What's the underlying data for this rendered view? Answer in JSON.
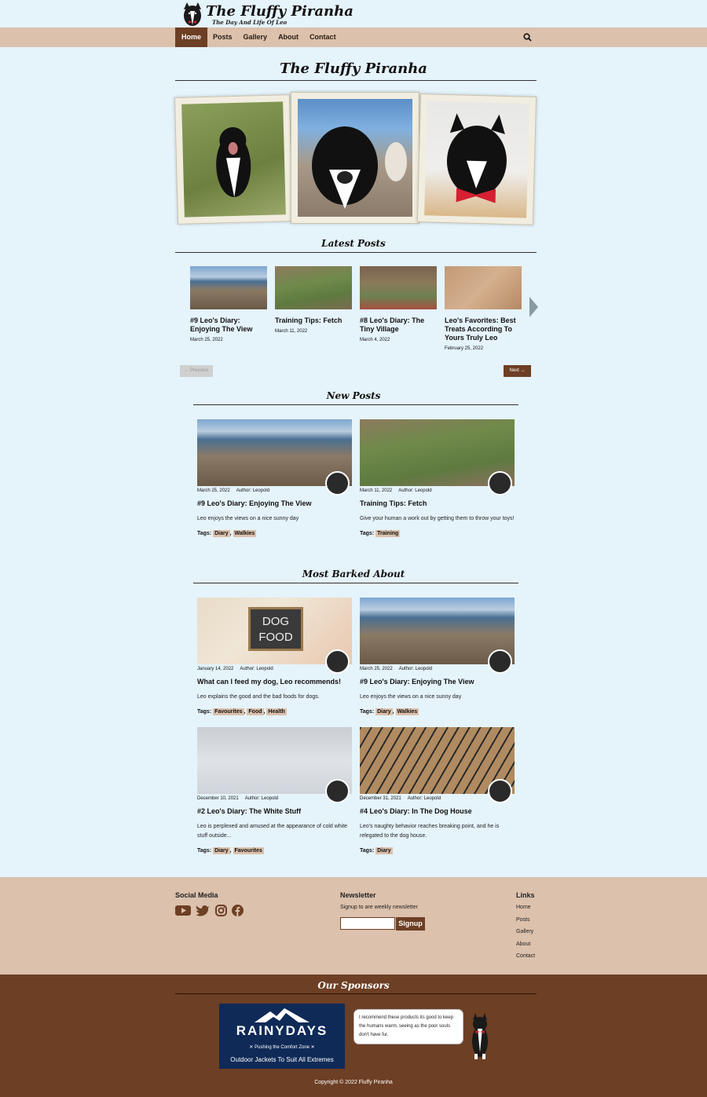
{
  "site": {
    "title": "The Fluffy Piranha",
    "tagline": "The Day And Life Of Leo"
  },
  "nav": {
    "items": [
      "Home",
      "Posts",
      "Gallery",
      "About",
      "Contact"
    ],
    "active": "Home"
  },
  "hero": {
    "title": "The Fluffy Piranha"
  },
  "latest": {
    "title": "Latest Posts",
    "posts": [
      {
        "title": "#9 Leo's Diary: Enjoying The View",
        "date": "March 25, 2022"
      },
      {
        "title": "Training Tips: Fetch",
        "date": "March 11, 2022"
      },
      {
        "title": "#8 Leo's Diary: The Tiny Village",
        "date": "March 4, 2022"
      },
      {
        "title": "Leo's Favorites: Best Treats According To Yours Truly Leo",
        "date": "February 25, 2022"
      }
    ],
    "prev": "← Previous",
    "next": "Next →"
  },
  "new_posts": {
    "title": "New Posts",
    "posts": [
      {
        "date": "March 25, 2022",
        "author": "Author: Leopold",
        "title": "#9 Leo's Diary: Enjoying The View",
        "excerpt": "Leo enjoys the views on a nice sunny day",
        "tags_label": "Tags:",
        "tags": [
          "Diary",
          "Walkies"
        ]
      },
      {
        "date": "March 11, 2022",
        "author": "Author: Leopold",
        "title": "Training Tips: Fetch",
        "excerpt": "Give your human a work out by getting them to throw your toys!",
        "tags_label": "Tags:",
        "tags": [
          "Training"
        ]
      }
    ]
  },
  "barked": {
    "title": "Most Barked About",
    "posts": [
      {
        "date": "January 14, 2022",
        "author": "Author: Leopold",
        "title": "What can I feed my dog, Leo recommends!",
        "excerpt": "Leo explains the good and the bad foods for dogs.",
        "tags_label": "Tags:",
        "tags": [
          "Favourites",
          "Food",
          "Health"
        ],
        "image_text": [
          "DOG",
          "FOOD"
        ]
      },
      {
        "date": "March 25, 2022",
        "author": "Author: Leopold",
        "title": "#9 Leo's Diary: Enjoying The View",
        "excerpt": "Leo enjoys the views on a nice sunny day",
        "tags_label": "Tags:",
        "tags": [
          "Diary",
          "Walkies"
        ]
      },
      {
        "date": "December 10, 2021",
        "author": "Author: Leopold",
        "title": "#2 Leo's Diary: The White Stuff",
        "excerpt": "Leo is perplexed and amused at the appearance of cold white stuff outside...",
        "tags_label": "Tags:",
        "tags": [
          "Diary",
          "Favourites"
        ]
      },
      {
        "date": "December 31, 2021",
        "author": "Author: Leopold",
        "title": "#4 Leo's Diary: In The Dog House",
        "excerpt": "Leo's naughty behavior reaches breaking point, and he is relegated to the dog house.",
        "tags_label": "Tags:",
        "tags": [
          "Diary"
        ]
      }
    ]
  },
  "footer": {
    "social_title": "Social Media",
    "social_icons": [
      "youtube-icon",
      "twitter-icon",
      "instagram-icon",
      "facebook-icon"
    ],
    "newsletter_title": "Newsletter",
    "newsletter_text": "Signup to are weekly newsletter",
    "signup_label": "Signup",
    "links_title": "Links",
    "links": [
      "Home",
      "Posts",
      "Gallery",
      "About",
      "Contact"
    ]
  },
  "sponsors": {
    "title": "Our Sponsors",
    "brand": "RAINYDAYS",
    "brand_sub": "✕ Pushing the Comfort Zone ✕",
    "brand_line": "Outdoor Jackets To Suit All Extremes",
    "bubble": "I recommend these products its good to keep the humans warm, seeing as the poor souls don't have fur."
  },
  "copyright": "Copyright © 2022 Fluffy Piranha",
  "colors": {
    "nav_bg": "#dcc1ac",
    "accent": "#6d3f24",
    "page_bg": "#e5f3fb",
    "sponsor": "#0f2a57"
  }
}
